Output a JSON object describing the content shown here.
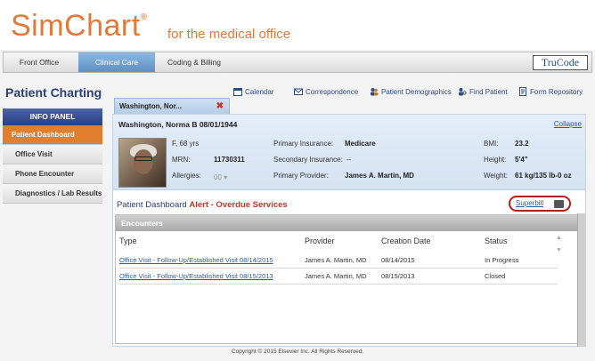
{
  "brand": {
    "logo": "SimChart",
    "reg": "®",
    "subtitle": "for the medical office",
    "logo_color": "#e07a3a"
  },
  "topnav": {
    "tabs": [
      {
        "label": "Front Office",
        "active": false
      },
      {
        "label": "Clinical Care",
        "active": true
      },
      {
        "label": "Coding & Billing",
        "active": false
      }
    ],
    "trucode": "TruCode"
  },
  "page_title": "Patient Charting",
  "toolbar": {
    "calendar": "Calendar",
    "correspondence": "Correspondence",
    "demographics": "Patient Demographics",
    "find_patient": "Find Patient",
    "form_repository": "Form Repository"
  },
  "left_panel": {
    "header": "INFO PANEL",
    "items": [
      {
        "label": "Patient Dashboard",
        "active": true
      },
      {
        "label": "Office Visit",
        "active": false
      },
      {
        "label": "Phone Encounter",
        "active": false
      },
      {
        "label": "Diagnostics / Lab Results",
        "active": false
      }
    ]
  },
  "patient_tab": {
    "label": "Washington, Nor...",
    "close": "✖"
  },
  "patient": {
    "name_line": "Washington, Norma B 08/01/1944",
    "collapse": "Collapse",
    "sex_age": "F, 68 yrs",
    "mrn_label": "MRN:",
    "mrn": "11730311",
    "allergies_label": "Allergies:",
    "allergies": "00",
    "primary_ins_label": "Primary Insurance:",
    "primary_ins": "Medicare",
    "secondary_ins_label": "Secondary Insurance:",
    "secondary_ins": "--",
    "provider_label": "Primary Provider:",
    "provider": "James A. Martin, MD",
    "bmi_label": "BMI:",
    "bmi": "23.2",
    "height_label": "Height:",
    "height": "5'4\"",
    "weight_label": "Weight:",
    "weight": "61 kg/135 lb-0 oz"
  },
  "dashboard": {
    "title": "Patient Dashboard",
    "alert": "Alert - Overdue Services",
    "superbill": "Superbill"
  },
  "encounters": {
    "header": "Encounters",
    "columns": [
      "Type",
      "Provider",
      "Creation Date",
      "Status"
    ],
    "rows": [
      {
        "type": "Office Visit - Follow-Up/Established Visit 08/14/2015",
        "provider": "James A. Martin, MD",
        "date": "08/14/2015",
        "status": "In Progress"
      },
      {
        "type": "Office Visit - Follow-Up/Established Visit 08/15/2013",
        "provider": "James A. Martin, MD",
        "date": "08/15/2013",
        "status": "Closed"
      }
    ]
  },
  "footer": "Copyright © 2015 Elsevier Inc. All Rights Reserved."
}
